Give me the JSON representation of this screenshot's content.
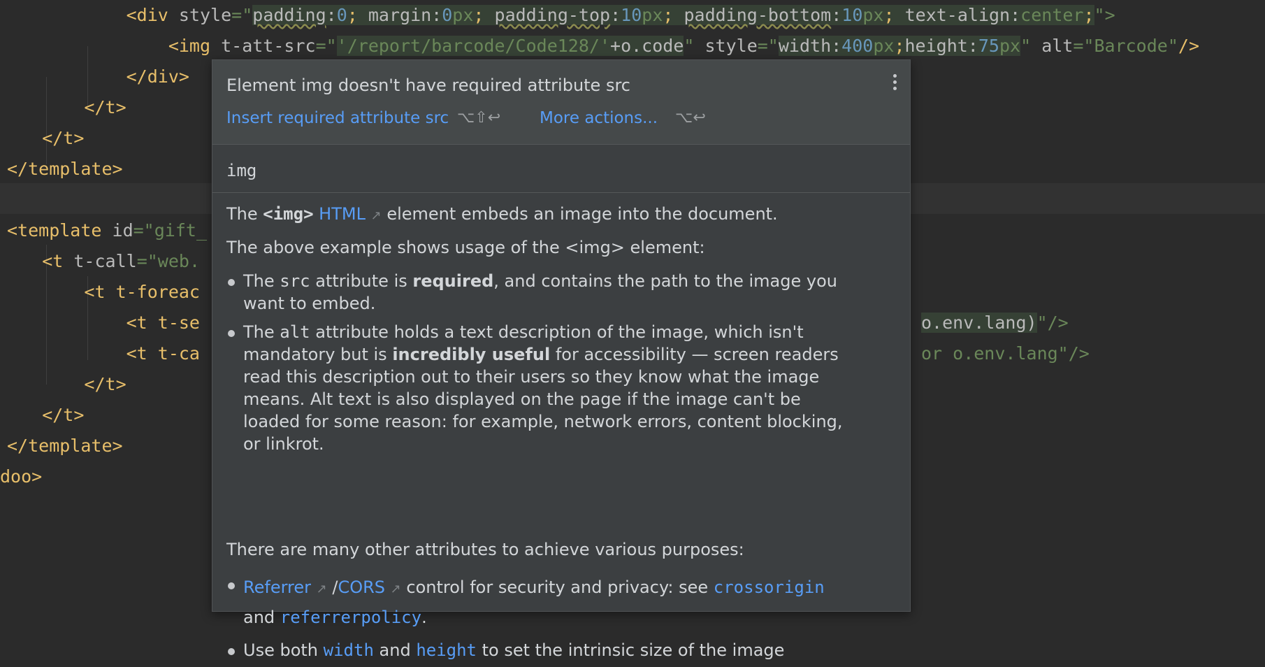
{
  "editor": {
    "line1": {
      "indent": "            ",
      "open": "<div ",
      "attr": "style",
      "eq": "=\"",
      "p1": "padding",
      "c1": ":",
      "v1": "0",
      "s1": "; ",
      "p2": "margin",
      "c2": ":",
      "v2n": "0",
      "v2u": "px",
      "s2": "; ",
      "p3": "padding-top",
      "c3": ":",
      "v3n": "10",
      "v3u": "px",
      "s3": "; ",
      "p4": "padding-bottom",
      "c4": ":",
      "v4n": "10",
      "v4u": "px",
      "s4": "; ",
      "p5": "text-align",
      "c5": ":",
      "v5": "center",
      "s5": ";",
      "close": "\">"
    },
    "line2": {
      "indent": "                ",
      "open": "<img ",
      "attr1": "t-att-src",
      "eq1": "=\"",
      "expr1": "'/report/barcode/Code128/'",
      "expr2": "+o.code",
      "q1": "\"",
      "attr2": " style",
      "eq2": "=\"",
      "w": "width:",
      "wn": "400",
      "wu": "px",
      "semi": ";",
      "h": "height:",
      "hn": "75",
      "hu": "px",
      "q2": "\"",
      "attr3": " alt",
      "eq3": "=\"",
      "alt": "Barcode",
      "q3": "\"",
      "end": "/>"
    },
    "line3": "            </div>",
    "line4": "        </t>",
    "line5": "    </t>",
    "line6": "</template>",
    "line8": {
      "open": "<template ",
      "attr": "id",
      "eq": "=\"",
      "val": "gift_"
    },
    "line9": {
      "indent": "    ",
      "open": "<t ",
      "attr": "t-call",
      "eq": "=\"",
      "val": "web."
    },
    "line10": "        <t t-foreac",
    "line11": {
      "left": "            <t t-se",
      "right_val": "o.env.lang)",
      "right_end": "\"/>"
    },
    "line12": {
      "left": "            <t t-ca",
      "right_val": "or o.env.lang",
      "right_end": "\"/>"
    },
    "line13": "        </t>",
    "line14": "    </t>",
    "line15": "</template>",
    "line16": "doo>"
  },
  "popup": {
    "title": "Element img doesn't have required attribute src",
    "action_insert": "Insert required attribute src",
    "shortcut_insert": "⌥⇧↩",
    "action_more": "More actions...",
    "shortcut_more": "⌥↩",
    "tag_name": "img",
    "doc": {
      "p1_a": "The ",
      "p1_tag": "<img>",
      "p1_link": "HTML",
      "p1_arrow": "↗",
      "p1_b": " element embeds an image into the document.",
      "p2": "The above example shows usage of the <img> element:",
      "b1_a": "The ",
      "b1_code": "src",
      "b1_b": " attribute is ",
      "b1_bold": "required",
      "b1_c": ", and contains the path to the image you want to embed.",
      "b2_a": "The ",
      "b2_code": "alt",
      "b2_b": " attribute holds a text description of the image, which isn't mandatory but is ",
      "b2_bold": "incredibly useful",
      "b2_c": " for accessibility — screen readers read this description out to their users so they know what the image means. Alt text is also displayed on the page if the image can't be loaded for some reason: for example, network errors, content blocking, or linkrot.",
      "p3": "There are many other attributes to achieve various purposes:",
      "b3_link1": "Referrer",
      "b3_arrow1": "↗",
      "b3_slash": " /",
      "b3_link2": "CORS",
      "b3_arrow2": "↗",
      "b3_a": "  control for security and privacy: see ",
      "b3_code1": "crossorigin",
      "b3_and": " and ",
      "b3_code2": "referrerpolicy",
      "b3_end": ".",
      "b4_a": "Use both ",
      "b4_code1": "width",
      "b4_and": " and ",
      "b4_code2": "height",
      "b4_b": " to set the intrinsic size of the image"
    }
  }
}
